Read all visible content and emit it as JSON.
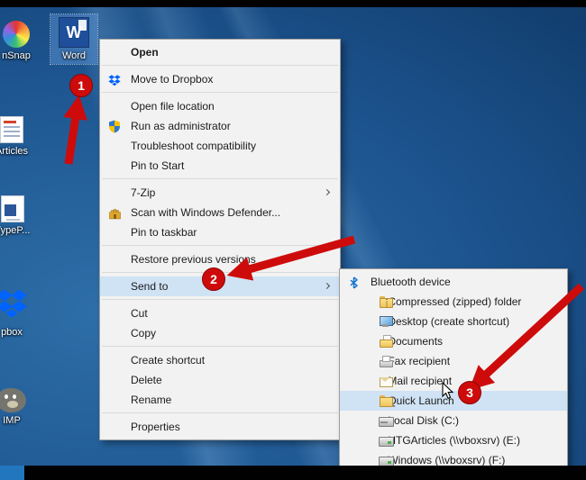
{
  "desktop": {
    "icons": [
      {
        "label": "nSnap"
      },
      {
        "label": "Word",
        "selected": true,
        "glyph": "W"
      },
      {
        "label": "Articles"
      },
      {
        "label": "TypeP..."
      },
      {
        "label": "pbox"
      },
      {
        "label": "IMP"
      }
    ]
  },
  "context_menu": {
    "items": [
      {
        "label": "Open"
      },
      {
        "label": "Move to Dropbox"
      },
      {
        "label": "Open file location"
      },
      {
        "label": "Run as administrator"
      },
      {
        "label": "Troubleshoot compatibility"
      },
      {
        "label": "Pin to Start"
      },
      {
        "label": "7-Zip"
      },
      {
        "label": "Scan with Windows Defender..."
      },
      {
        "label": "Pin to taskbar"
      },
      {
        "label": "Restore previous versions"
      },
      {
        "label": "Send to"
      },
      {
        "label": "Cut"
      },
      {
        "label": "Copy"
      },
      {
        "label": "Create shortcut"
      },
      {
        "label": "Delete"
      },
      {
        "label": "Rename"
      },
      {
        "label": "Properties"
      }
    ]
  },
  "send_to_menu": {
    "items": [
      {
        "label": "Bluetooth device"
      },
      {
        "label": "Compressed (zipped) folder"
      },
      {
        "label": "Desktop (create shortcut)"
      },
      {
        "label": "Documents"
      },
      {
        "label": "Fax recipient"
      },
      {
        "label": "Mail recipient"
      },
      {
        "label": "Quick Launch"
      },
      {
        "label": "Local Disk (C:)"
      },
      {
        "label": "HTGArticles (\\\\vboxsrv) (E:)"
      },
      {
        "label": "Windows (\\\\vboxsrv) (F:)"
      }
    ]
  },
  "annotations": {
    "step1": "1",
    "step2": "2",
    "step3": "3"
  },
  "colors": {
    "annotation_red": "#ce0b0b",
    "menu_bg": "#f2f2f2",
    "menu_highlight": "#d0e3f5",
    "desktop_blue": "#1d5590",
    "word_blue": "#1f4e9a"
  }
}
